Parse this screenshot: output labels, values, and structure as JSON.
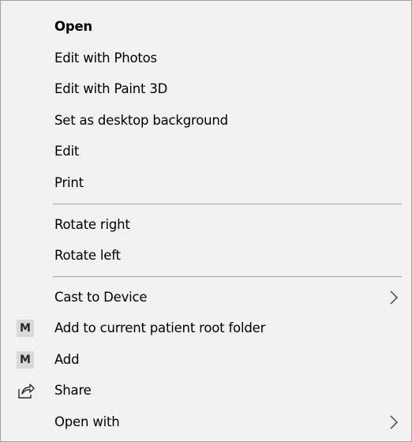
{
  "menu": {
    "items": [
      {
        "label": "Open"
      },
      {
        "label": "Edit with Photos"
      },
      {
        "label": "Edit with Paint 3D"
      },
      {
        "label": "Set as desktop background"
      },
      {
        "label": "Edit"
      },
      {
        "label": "Print"
      },
      {
        "label": "Rotate right"
      },
      {
        "label": "Rotate left"
      },
      {
        "label": "Cast to Device"
      },
      {
        "label": "Add to current patient root folder",
        "icon_text": "M"
      },
      {
        "label": "Add",
        "icon_text": "M"
      },
      {
        "label": "Share"
      },
      {
        "label": "Open with"
      }
    ]
  },
  "icons": {
    "submenu": "chevron-right-icon",
    "share": "share-icon",
    "m_badge": "m-badge-icon"
  },
  "colors": {
    "background": "#f2f2f2",
    "border": "#a0a0a0",
    "separator": "#a0a0a0",
    "badge": "#d9d9d9"
  }
}
